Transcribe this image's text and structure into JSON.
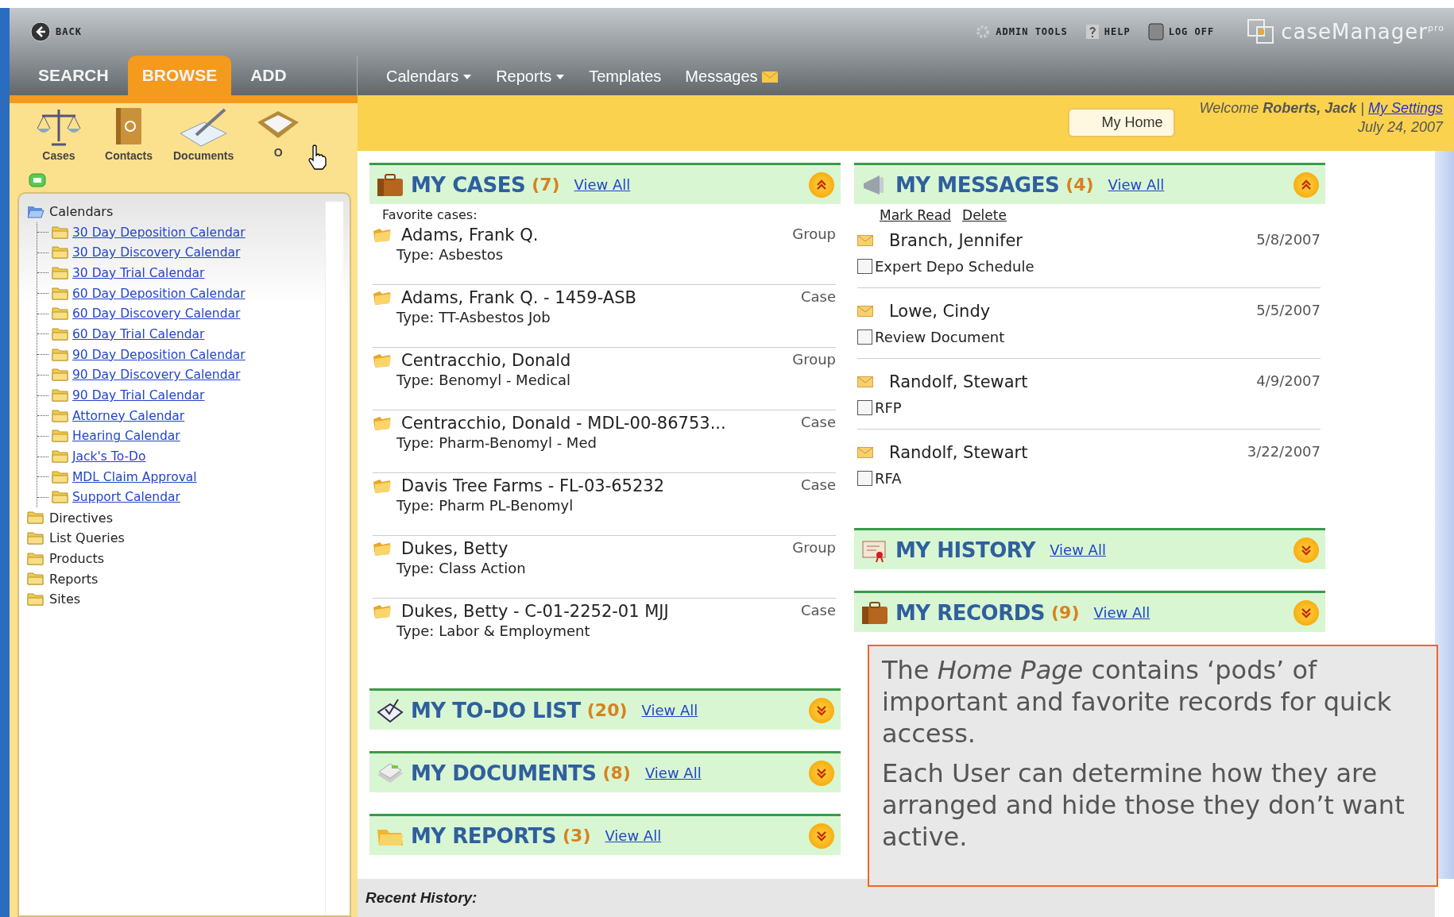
{
  "header": {
    "back": "BACK",
    "links": [
      {
        "kind": "admin",
        "label": "ADMIN TOOLS"
      },
      {
        "kind": "help",
        "label": "HELP"
      },
      {
        "kind": "logoff",
        "label": "LOG OFF"
      }
    ],
    "logo": "caseManager",
    "logo_sup": "pro"
  },
  "tabs": [
    {
      "label": "SEARCH",
      "selected": false
    },
    {
      "label": "BROWSE",
      "selected": true
    },
    {
      "label": "ADD",
      "selected": false
    }
  ],
  "menu": [
    {
      "kind": "dropdown",
      "label": "Calendars"
    },
    {
      "kind": "dropdown",
      "label": "Reports"
    },
    {
      "kind": "plain",
      "label": "Templates"
    },
    {
      "kind": "mail",
      "label": "Messages"
    }
  ],
  "browse_items": [
    {
      "kind": "scales",
      "label": "Cases"
    },
    {
      "kind": "contacts",
      "label": "Contacts"
    },
    {
      "kind": "document",
      "label": "Documents"
    },
    {
      "kind": "tray",
      "label": "O"
    }
  ],
  "tree": [
    {
      "label": "Calendars",
      "expanded": true,
      "children": [
        {
          "label": "30 Day Deposition Calendar"
        },
        {
          "label": "30 Day Discovery Calendar"
        },
        {
          "label": "30 Day Trial Calendar"
        },
        {
          "label": "60 Day Deposition Calendar"
        },
        {
          "label": "60 Day Discovery Calendar"
        },
        {
          "label": "60 Day Trial Calendar"
        },
        {
          "label": "90 Day Deposition Calendar"
        },
        {
          "label": "90 Day Discovery Calendar"
        },
        {
          "label": "90 Day Trial Calendar"
        },
        {
          "label": "Attorney Calendar"
        },
        {
          "label": "Hearing Calendar"
        },
        {
          "label": "Jack's To-Do"
        },
        {
          "label": "MDL Claim Approval"
        },
        {
          "label": "Support Calendar"
        }
      ]
    },
    {
      "label": "Directives",
      "expanded": false
    },
    {
      "label": "List Queries",
      "expanded": false
    },
    {
      "label": "Products",
      "expanded": false
    },
    {
      "label": "Reports",
      "expanded": false
    },
    {
      "label": "Sites",
      "expanded": false
    }
  ],
  "home_button": "My Home",
  "welcome": {
    "text": "Welcome **Roberts, Jack** |",
    "settings": "My Settings",
    "date": "July 24, 2007"
  },
  "pods_left": [
    {
      "kind": "briefcase",
      "title": "MY CASES",
      "count": "(7)",
      "link": "View All",
      "expanded": true,
      "subtitle": "Favorite cases:",
      "cases": [
        {
          "name": "Adams, Frank Q.",
          "type": "Type: Asbestos",
          "category": "Group"
        },
        {
          "name": "Adams, Frank Q. - 1459-ASB",
          "type": "Type: TT-Asbestos Job",
          "category": "Case"
        },
        {
          "name": "Centracchio, Donald",
          "type": "Type: Benomyl - Medical",
          "category": "Group"
        },
        {
          "name": "Centracchio, Donald - MDL-00-86753...",
          "type": "Type: Pharm-Benomyl - Med",
          "category": "Case"
        },
        {
          "name": "Davis Tree Farms - FL-03-65232",
          "type": "Type: Pharm PL-Benomyl",
          "category": "Case"
        },
        {
          "name": "Dukes, Betty",
          "type": "Type: Class Action",
          "category": "Group"
        },
        {
          "name": "Dukes, Betty - C-01-2252-01 MJJ",
          "type": "Type: Labor & Employment",
          "category": "Case"
        }
      ]
    },
    {
      "kind": "todo",
      "title": "MY TO-DO LIST",
      "count": "(20)",
      "link": "View All",
      "expanded": false
    },
    {
      "kind": "documents",
      "title": "MY DOCUMENTS",
      "count": "(8)",
      "link": "View All",
      "expanded": false
    },
    {
      "kind": "folder",
      "title": "MY REPORTS",
      "count": "(3)",
      "link": "View All",
      "expanded": false
    }
  ],
  "pods_right": [
    {
      "kind": "megaphone",
      "title": "MY MESSAGES",
      "count": "(4)",
      "link": "View All",
      "expanded": true,
      "actions": [
        "Mark Read",
        "Delete"
      ],
      "messages": [
        {
          "from": "Branch, Jennifer",
          "date": "5/8/2007",
          "subject": "Expert Depo Schedule",
          "checked": false
        },
        {
          "from": "Lowe, Cindy",
          "date": "5/5/2007",
          "subject": "Review Document",
          "checked": false
        },
        {
          "from": "Randolf, Stewart",
          "date": "4/9/2007",
          "subject": "RFP",
          "checked": false
        },
        {
          "from": "Randolf, Stewart",
          "date": "3/22/2007",
          "subject": "RFA",
          "checked": false
        }
      ]
    },
    {
      "kind": "history",
      "title": "MY HISTORY",
      "link": "View All",
      "expanded": false
    },
    {
      "kind": "briefcase",
      "title": "MY RECORDS",
      "count": "(9)",
      "link": "View All",
      "expanded": false
    }
  ],
  "callout": [
    "The *Home Page* contains ‘pods’ of important and favorite records for quick access.",
    "Each User can determine how they are arranged and hide those they don’t want active."
  ],
  "recent_history": "Recent History:"
}
